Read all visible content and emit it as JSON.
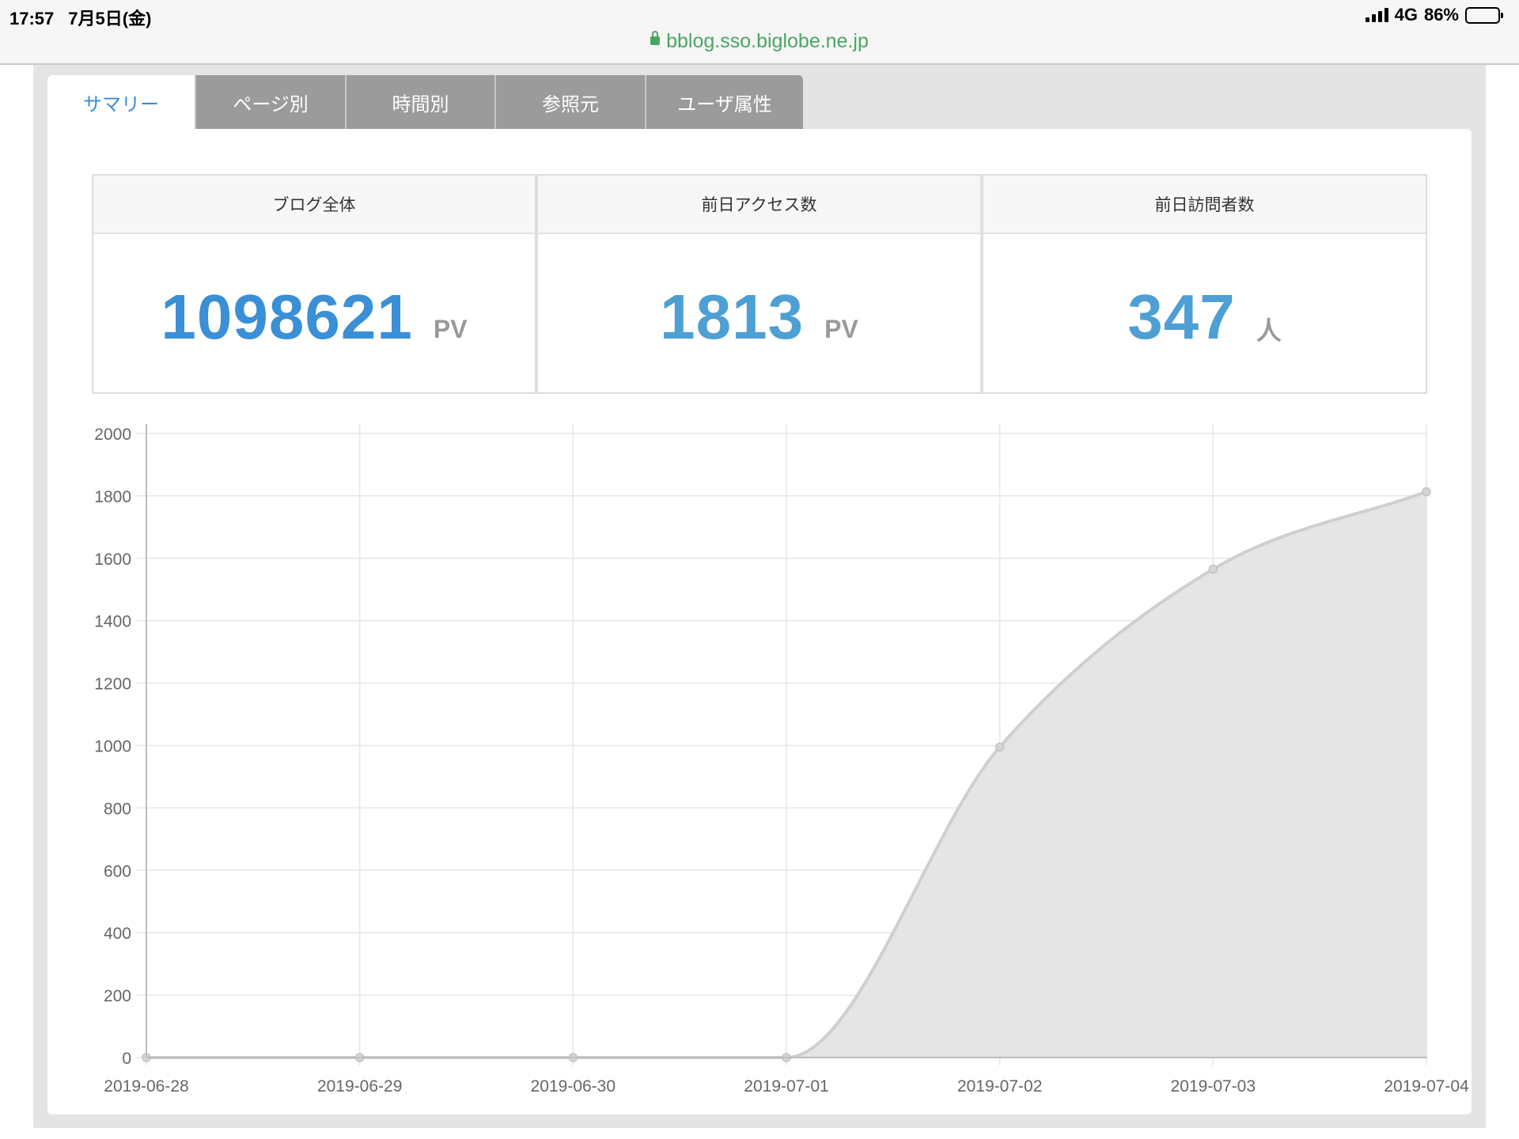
{
  "status_bar": {
    "time": "17:57",
    "date": "7月5日(金)",
    "network": "4G",
    "battery": "86%",
    "battery_level": 0.86,
    "url": "bblog.sso.biglobe.ne.jp"
  },
  "tabs": [
    {
      "label": "サマリー",
      "active": true
    },
    {
      "label": "ページ別",
      "active": false
    },
    {
      "label": "時間別",
      "active": false
    },
    {
      "label": "参照元",
      "active": false
    },
    {
      "label": "ユーザ属性",
      "active": false
    }
  ],
  "stats": [
    {
      "title": "ブログ全体",
      "value": "1098621",
      "unit": "PV",
      "color": "#3a8fd6"
    },
    {
      "title": "前日アクセス数",
      "value": "1813",
      "unit": "PV",
      "color": "#4d9fd4"
    },
    {
      "title": "前日訪問者数",
      "value": "347",
      "unit": "人",
      "color": "#4d9fd4"
    }
  ],
  "colors": {
    "accent": "#3a8fd6",
    "tab_inactive": "#9b9b9b",
    "area_fill": "#e5e5e5",
    "line": "#cfcfcf"
  },
  "chart_data": {
    "type": "area",
    "x": [
      "2019-06-28",
      "2019-06-29",
      "2019-06-30",
      "2019-07-01",
      "2019-07-02",
      "2019-07-03",
      "2019-07-04"
    ],
    "series": [
      {
        "values": [
          0,
          0,
          0,
          0,
          995,
          1565,
          1813
        ]
      }
    ],
    "title": "",
    "xlabel": "",
    "ylabel": "",
    "ylim": [
      0,
      2000
    ],
    "yticks": [
      0,
      200,
      400,
      600,
      800,
      1000,
      1200,
      1400,
      1600,
      1800,
      2000
    ],
    "grid": true,
    "legend": "none"
  }
}
